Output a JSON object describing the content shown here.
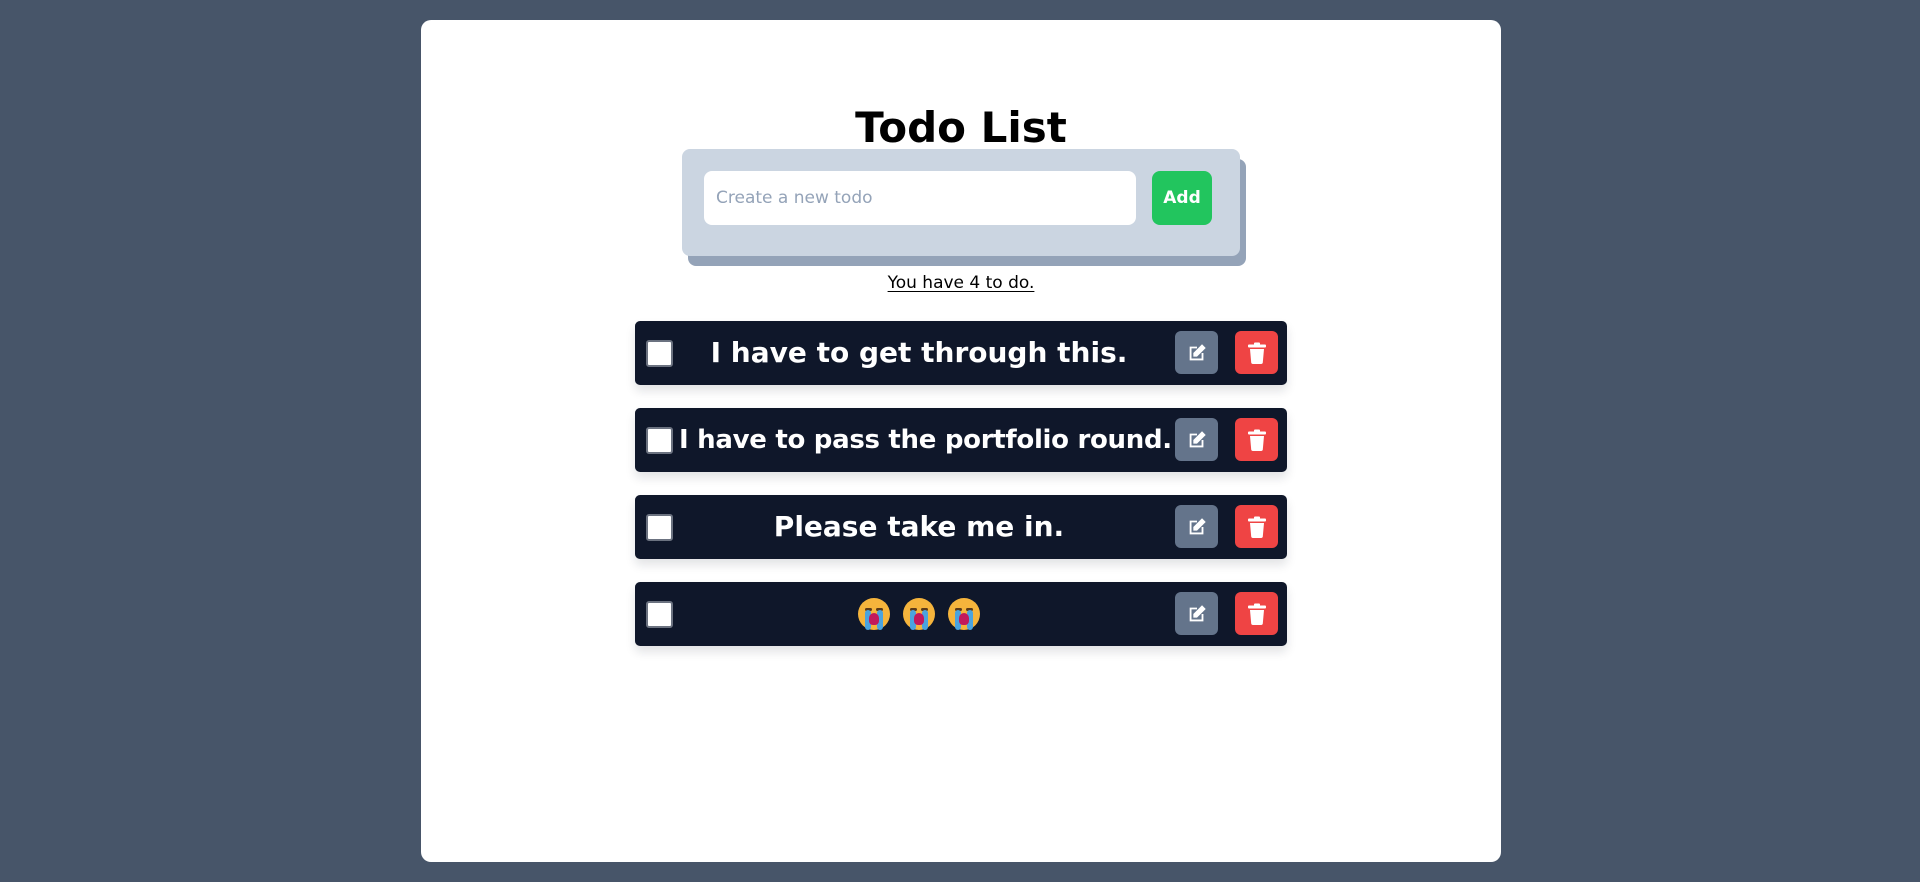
{
  "app": {
    "title": "Todo List"
  },
  "form": {
    "input_placeholder": "Create a new todo",
    "input_value": "",
    "add_label": "Add"
  },
  "status": {
    "count_text": "You have 4 to do."
  },
  "todos": [
    {
      "text": "I have to get through this.",
      "checked": false,
      "icon_edit": "edit-icon",
      "icon_delete": "trash-icon"
    },
    {
      "text": "I have to pass the portfolio round.",
      "checked": false,
      "icon_edit": "edit-icon",
      "icon_delete": "trash-icon"
    },
    {
      "text": "Please take me in.",
      "checked": false,
      "icon_edit": "edit-icon",
      "icon_delete": "trash-icon"
    },
    {
      "text": "😭😭😭",
      "checked": false,
      "icon_edit": "edit-icon",
      "icon_delete": "trash-icon"
    }
  ],
  "colors": {
    "page_background": "#475569",
    "card": "#ffffff",
    "form_box": "#cbd5e1",
    "form_shadow": "#94a3b8",
    "add_button": "#22c55e",
    "todo_item": "#0f172a",
    "edit_button": "#64748b",
    "delete_button": "#ef4444"
  }
}
